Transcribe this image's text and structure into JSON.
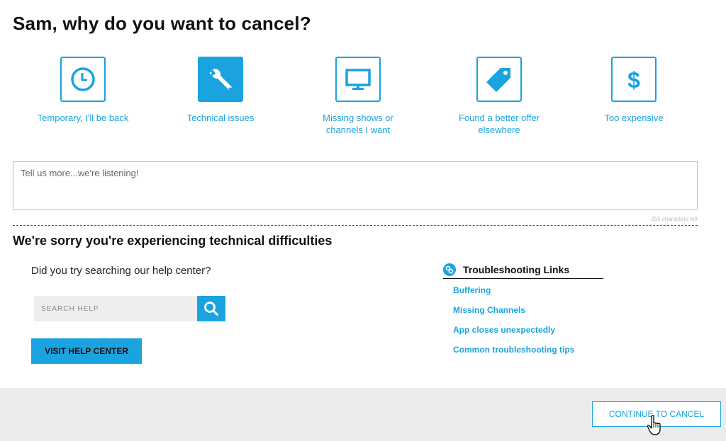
{
  "header": {
    "title": "Sam, why do you want to cancel?"
  },
  "reasons": [
    {
      "label": "Temporary, I'll be back",
      "icon": "clock-icon",
      "selected": false
    },
    {
      "label": "Technical issues",
      "icon": "wrench-icon",
      "selected": true
    },
    {
      "label": "Missing shows or channels I want",
      "icon": "monitor-icon",
      "selected": false
    },
    {
      "label": "Found a better offer elsewhere",
      "icon": "price-tag-icon",
      "selected": false
    },
    {
      "label": "Too expensive",
      "icon": "dollar-icon",
      "selected": false
    }
  ],
  "feedback": {
    "placeholder": "Tell us more...we're listening!",
    "value": "",
    "char_count": "255 characters left"
  },
  "technical": {
    "title": "We're sorry you're experiencing technical difficulties",
    "question": "Did you try searching our help center?",
    "search_placeholder": "SEARCH HELP",
    "visit_label": "VISIT HELP CENTER"
  },
  "troubleshooting": {
    "title": "Troubleshooting Links",
    "links": [
      "Buffering",
      "Missing Channels",
      "App closes unexpectedly",
      "Common troubleshooting tips"
    ]
  },
  "footer": {
    "continue_label": "CONTINUE TO CANCEL"
  },
  "colors": {
    "accent": "#1aa3df",
    "band": "#ececec"
  }
}
